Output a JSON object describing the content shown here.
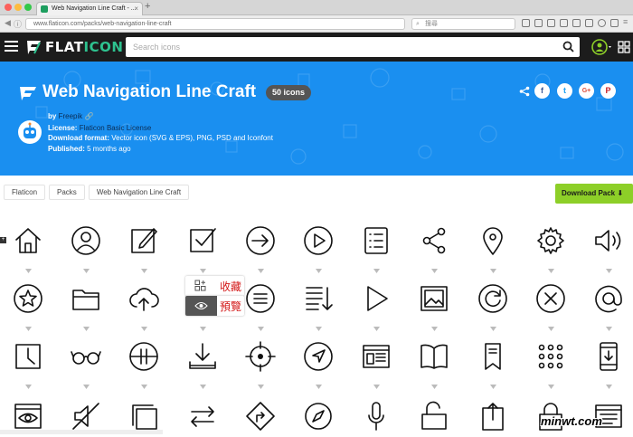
{
  "browser": {
    "tab_title": "Web Navigation Line Craft - ...",
    "url": "www.flaticon.com/packs/web-navigation-line-craft",
    "search_placeholder": "搜尋"
  },
  "header": {
    "logo_flat": "FLAT",
    "logo_icon": "ICON",
    "search_placeholder": "Search icons"
  },
  "pack": {
    "title": "Web Navigation Line Craft",
    "count": "50 icons",
    "by_label": "by",
    "author": "Freepik",
    "license_label": "License:",
    "license": "Flaticon Basic License",
    "format_label": "Download format:",
    "format": "Vector icon (SVG & EPS), PNG, PSD and Iconfont",
    "published_label": "Published:",
    "published": "5 months ago",
    "share_buttons": [
      "f",
      "t",
      "G+",
      "P"
    ]
  },
  "breadcrumb": [
    "Flaticon",
    "Packs",
    "Web Navigation Line Craft"
  ],
  "download_button": "Download Pack",
  "icons": [
    [
      "home-icon",
      "user-icon",
      "edit-icon",
      "checkbox-icon",
      "arrow-right-icon",
      "play-icon",
      "list-icon",
      "share-icon",
      "location-pin-icon",
      "gear-icon",
      "speaker-icon"
    ],
    [
      "star-icon",
      "folder-icon",
      "cloud-upload-icon",
      "grid-icon",
      "menu-circle-icon",
      "sort-down-icon",
      "play-triangle-icon",
      "image-icon",
      "refresh-icon",
      "close-circle-icon",
      "at-sign-icon"
    ],
    [
      "clock-icon",
      "glasses-icon",
      "pause-circle-icon",
      "download-icon",
      "target-icon",
      "navigation-arrow-icon",
      "browser-window-icon",
      "book-icon",
      "bookmark-icon",
      "dots-grid-icon",
      "mobile-download-icon"
    ],
    [
      "view-window-icon",
      "mute-icon",
      "copy-squares-icon",
      "exchange-icon",
      "direction-sign-icon",
      "compass-icon",
      "microphone-icon",
      "unlock-icon",
      "upload-icon",
      "lock-icon",
      "list-window-icon"
    ]
  ],
  "overlay": {
    "collect": "收藏",
    "preview": "預覽"
  },
  "watermark": "minwt.com"
}
